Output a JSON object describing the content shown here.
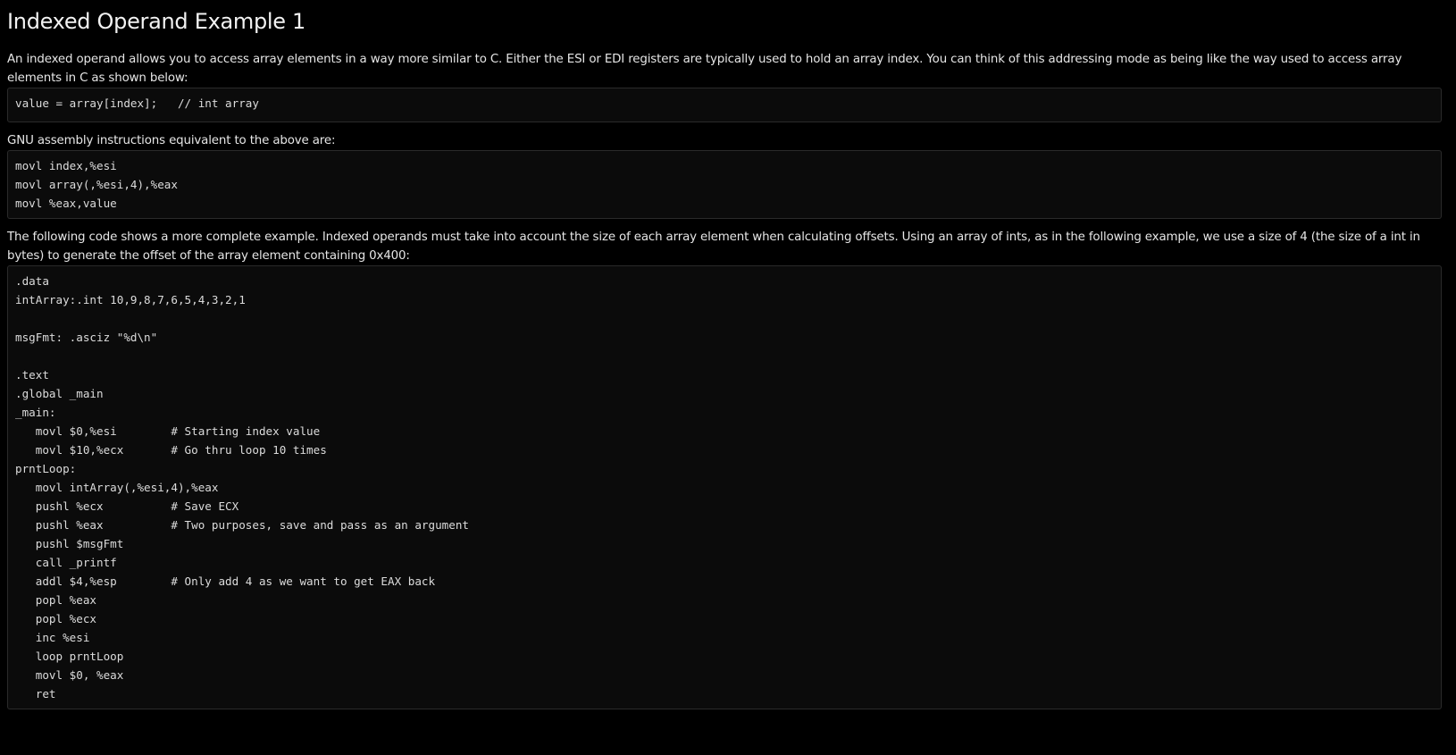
{
  "heading": "Indexed Operand Example 1",
  "intro_paragraph": "An indexed operand allows you to access array elements in a way more similar to C. Either the ESI or EDI registers are typically used to hold an array index. You can think of this addressing mode as being like the way used to access array elements in C as shown below:",
  "c_code": "value = array[index];   // int array",
  "gnu_paragraph": "GNU assembly instructions equivalent to the above are:",
  "asm_equivalent": "movl index,%esi\nmovl array(,%esi,4),%eax\nmovl %eax,value",
  "following_paragraph": "The following code shows a more complete example. Indexed operands must take into account the size of each array element when calculating offsets. Using an array of ints, as in the following example, we use a size of 4 (the size of a int in bytes) to generate the offset of the array element containing 0x400:",
  "full_example": ".data\nintArray:.int 10,9,8,7,6,5,4,3,2,1\n\nmsgFmt: .asciz \"%d\\n\"\n\n.text\n.global _main\n_main:\n   movl $0,%esi        # Starting index value\n   movl $10,%ecx       # Go thru loop 10 times\nprntLoop:\n   movl intArray(,%esi,4),%eax\n   pushl %ecx          # Save ECX\n   pushl %eax          # Two purposes, save and pass as an argument\n   pushl $msgFmt\n   call _printf\n   addl $4,%esp        # Only add 4 as we want to get EAX back\n   popl %eax\n   popl %ecx\n   inc %esi\n   loop prntLoop\n   movl $0, %eax\n   ret"
}
